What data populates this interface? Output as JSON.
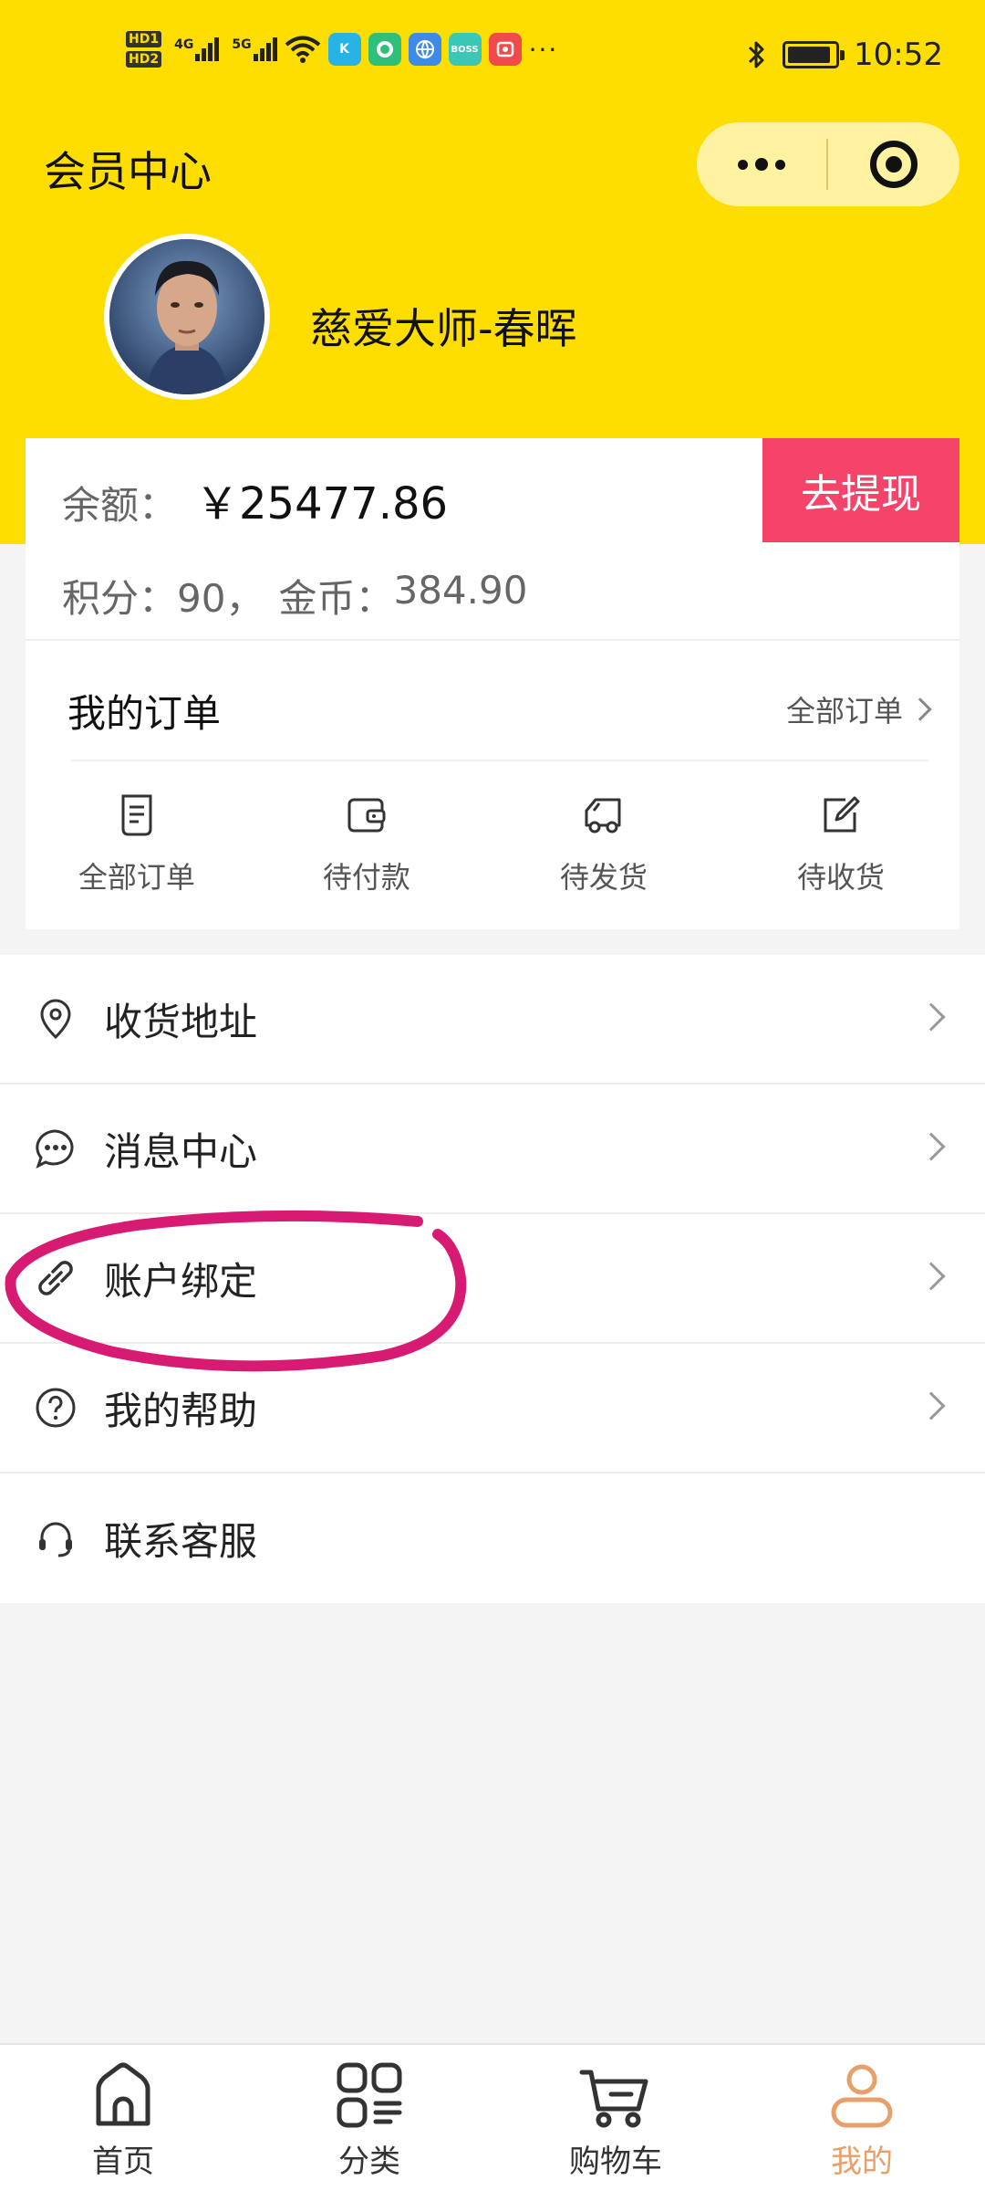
{
  "status_bar": {
    "hd_badges": [
      "HD1",
      "HD2"
    ],
    "network_labels": [
      "4G",
      "5G"
    ],
    "apps": [
      {
        "icon": "k-app-icon",
        "text": "K",
        "color": "#27b3e6"
      },
      {
        "icon": "bird-app-icon",
        "text": "",
        "color": "#2ebf7a"
      },
      {
        "icon": "globe-app-icon",
        "text": "",
        "color": "#3d8be8"
      },
      {
        "icon": "boss-app-icon",
        "text": "BOSS",
        "color": "#3ac7b5"
      },
      {
        "icon": "red-app-icon",
        "text": "",
        "color": "#f04a4a"
      }
    ],
    "more": "···",
    "time": "10:52"
  },
  "header": {
    "title": "会员中心"
  },
  "profile": {
    "nickname": "慈爱大师-春晖"
  },
  "balance": {
    "label": "余额：",
    "amount": "￥25477.86",
    "withdraw_label": "去提现",
    "points_label": "积分：",
    "points_value": "90，",
    "coins_label": "金币：",
    "coins_value": "384.90"
  },
  "orders": {
    "title": "我的订单",
    "all_link": "全部订单",
    "items": [
      {
        "label": "全部订单",
        "icon": "document-icon"
      },
      {
        "label": "待付款",
        "icon": "wallet-icon"
      },
      {
        "label": "待发货",
        "icon": "truck-icon"
      },
      {
        "label": "待收货",
        "icon": "edit-icon"
      }
    ]
  },
  "menu": [
    {
      "label": "收货地址",
      "icon": "location-pin-icon",
      "chevron": true
    },
    {
      "label": "消息中心",
      "icon": "chat-bubble-icon",
      "chevron": true
    },
    {
      "label": "账户绑定",
      "icon": "link-icon",
      "chevron": true
    },
    {
      "label": "我的帮助",
      "icon": "help-circle-icon",
      "chevron": true
    },
    {
      "label": "联系客服",
      "icon": "headset-icon",
      "chevron": false
    }
  ],
  "tabs": [
    {
      "label": "首页",
      "icon": "home-icon",
      "active": false
    },
    {
      "label": "分类",
      "icon": "category-grid-icon",
      "active": false
    },
    {
      "label": "购物车",
      "icon": "cart-icon",
      "active": false
    },
    {
      "label": "我的",
      "icon": "user-icon",
      "active": true
    }
  ],
  "colors": {
    "header_yellow": "#fedd00",
    "withdraw_pink": "#f5436a",
    "active_tab": "#e8a06a",
    "annotation": "#d81b72"
  }
}
